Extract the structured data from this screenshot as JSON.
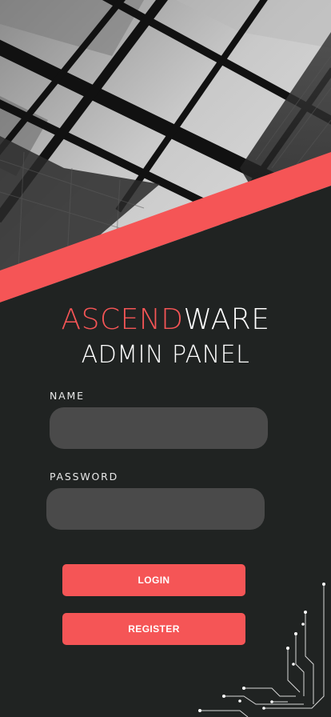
{
  "brand": {
    "accent_text": "ASCEND",
    "rest_text": "WARE",
    "subtitle": "ADMIN PANEL"
  },
  "form": {
    "name_label": "NAME",
    "name_value": "",
    "password_label": "PASSWORD",
    "password_value": ""
  },
  "buttons": {
    "login_label": "LOGIN",
    "register_label": "REGISTER"
  },
  "colors": {
    "accent": "#f55556",
    "background": "#202322",
    "field": "#4a4a4a"
  }
}
